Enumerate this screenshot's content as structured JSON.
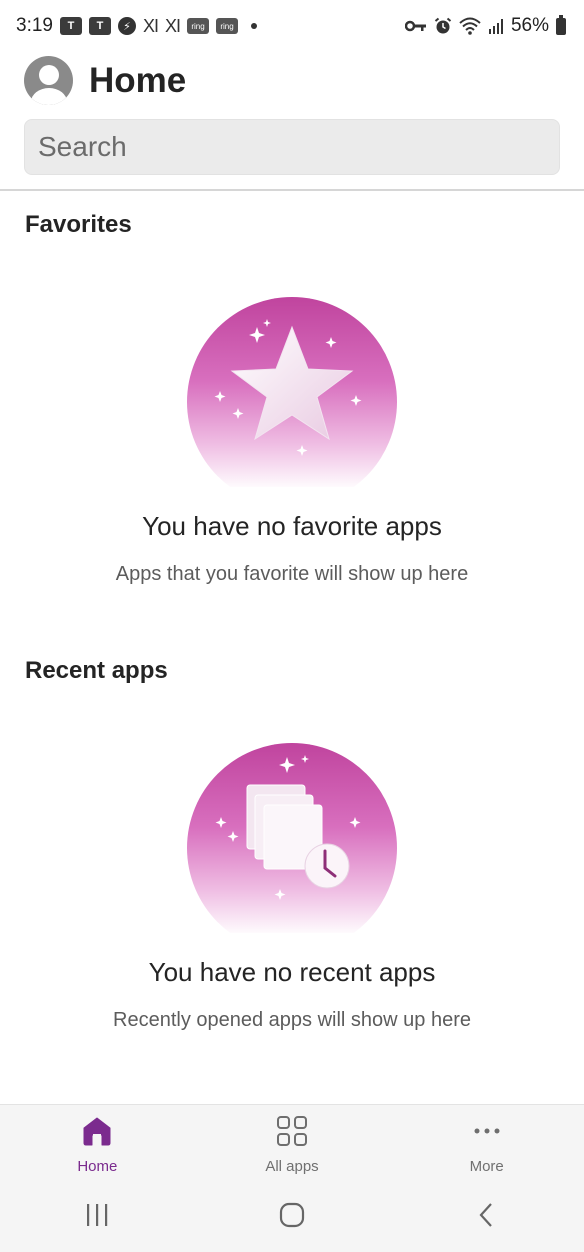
{
  "status_bar": {
    "time": "3:19",
    "battery": "56%",
    "notification_icons": [
      "teams-icon",
      "teams-icon",
      "messenger-icon",
      "xi-icon",
      "xi-icon",
      "ring-icon",
      "ring-icon",
      "dot-icon"
    ],
    "system_icons": [
      "key-icon",
      "alarm-icon",
      "wifi-icon",
      "signal-icon",
      "battery-icon"
    ]
  },
  "header": {
    "title": "Home"
  },
  "search": {
    "placeholder": "Search"
  },
  "favorites": {
    "title": "Favorites",
    "empty_title": "You have no favorite apps",
    "empty_subtitle": "Apps that you favorite will show up here"
  },
  "recent": {
    "title": "Recent apps",
    "empty_title": "You have no recent apps",
    "empty_subtitle": "Recently opened apps will show up here"
  },
  "bottom_nav": {
    "items": [
      {
        "label": "Home",
        "icon": "home-icon",
        "active": true
      },
      {
        "label": "All apps",
        "icon": "grid-icon",
        "active": false
      },
      {
        "label": "More",
        "icon": "more-icon",
        "active": false
      }
    ]
  },
  "colors": {
    "accent": "#7b2b8e",
    "illustration": "#c0449e"
  }
}
